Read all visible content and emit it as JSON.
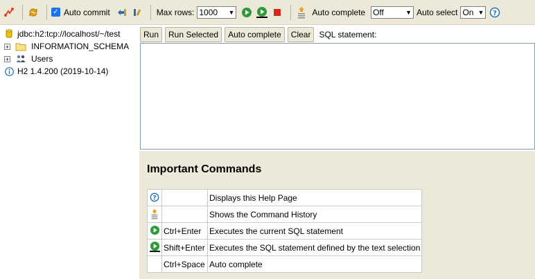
{
  "toolbar": {
    "auto_commit_label": "Auto commit",
    "max_rows_label": "Max rows:",
    "max_rows_value": "1000",
    "auto_complete_label": "Auto complete",
    "auto_complete_value": "Off",
    "auto_select_label": "Auto select",
    "auto_select_value": "On"
  },
  "tree": {
    "connection": "jdbc:h2:tcp://localhost/~/test",
    "schema": "INFORMATION_SCHEMA",
    "users": "Users",
    "version": "H2 1.4.200 (2019-10-14)"
  },
  "query": {
    "run": "Run",
    "run_selected": "Run Selected",
    "auto_complete": "Auto complete",
    "clear": "Clear",
    "sql_label": "SQL statement:"
  },
  "help": {
    "title": "Important Commands",
    "rows": [
      {
        "icon": "help-icon",
        "key": "",
        "desc": "Displays this Help Page"
      },
      {
        "icon": "history-icon",
        "key": "",
        "desc": "Shows the Command History"
      },
      {
        "icon": "run-icon",
        "key": "Ctrl+Enter",
        "desc": "Executes the current SQL statement"
      },
      {
        "icon": "run-selected-icon",
        "key": "Shift+Enter",
        "desc": "Executes the SQL statement defined by the text selection"
      },
      {
        "icon": "",
        "key": "Ctrl+Space",
        "desc": "Auto complete"
      }
    ]
  },
  "colors": {
    "toolbar_bg": "#ece9d8",
    "run_green": "#2e9b3a",
    "stop_red": "#d9261c",
    "help_blue": "#1f6fb7"
  }
}
